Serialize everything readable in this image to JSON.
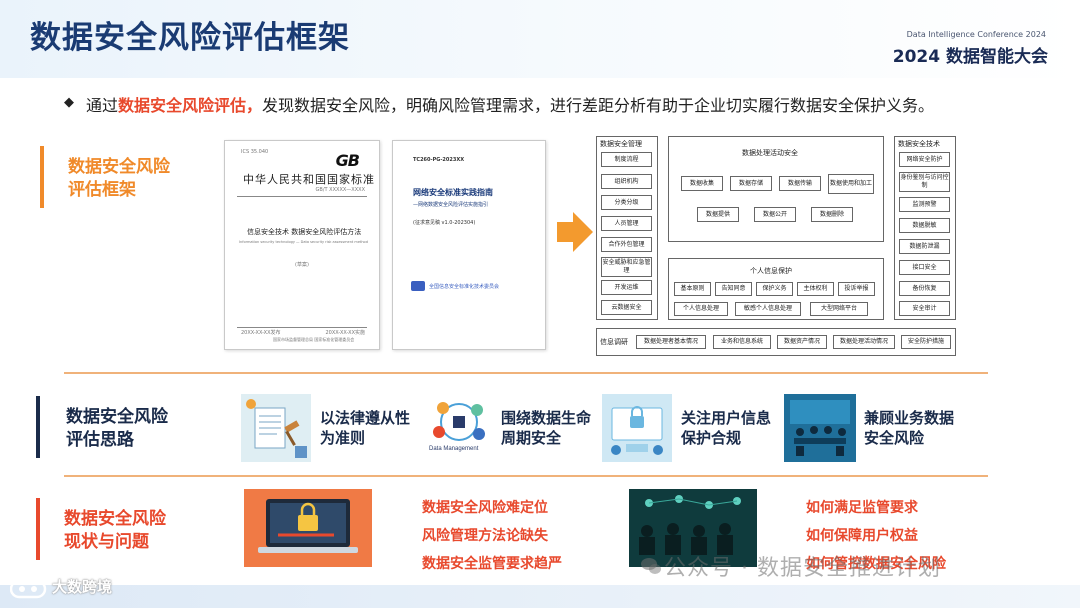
{
  "header": {
    "title": "数据安全风险评估框架",
    "conference_en": "Data Intelligence Conference 2024",
    "conference_cn": "2024 数据智能大会"
  },
  "intro": {
    "bullet": "◆",
    "prefix": "通过",
    "highlight": "数据安全风险评估，",
    "suffix": "发现数据安全风险，明确风险管理需求，进行差距分析有助于企业切实履行数据安全保护义务。"
  },
  "sections": {
    "framework": {
      "line1": "数据安全风险",
      "line2": "评估框架"
    },
    "thinking": {
      "line1": "数据安全风险",
      "line2": "评估思路"
    },
    "status": {
      "line1": "数据安全风险",
      "line2": "现状与问题"
    }
  },
  "doc_gb": {
    "code_small": "ICS 35.040",
    "logo": "GB",
    "standard": "中华人民共和国国家标准",
    "number": "GB/T XXXXX—XXXX",
    "title": "信息安全技术 数据安全风险评估方法",
    "title_en": "Information security technology — Data security risk assessment method",
    "draft": "(草案)",
    "date_pub": "20XX-XX-XX发布",
    "date_impl": "20XX-XX-XX实施",
    "issuer": "国家市场监督管理总局 国家标准化管理委员会"
  },
  "doc_tc": {
    "code": "TC260-PG-2023XX",
    "title": "网络安全标准实践指南",
    "subtitle": "—网络数据安全风险评估实施指引",
    "version": "(征求意见稿 v1.0-202304)",
    "org": "全国信息安全标准化技术委员会"
  },
  "framework": {
    "left_title": "数据安全管理",
    "left_items": [
      "制度流程",
      "组织机构",
      "分类分级",
      "人员管理",
      "合作外包管理",
      "安全威胁和应急管理",
      "开发运维",
      "云数据安全"
    ],
    "center_title": "数据处理活动安全",
    "center_row1": [
      "数据收集",
      "数据存储",
      "数据传输",
      "数据使用和加工"
    ],
    "center_row2": [
      "数据提供",
      "数据公开",
      "数据删除"
    ],
    "pi_title": "个人信息保护",
    "pi_row1": [
      "基本原则",
      "告知同意",
      "保护义务",
      "主体权利",
      "投诉举报"
    ],
    "pi_row2": [
      "个人信息处理",
      "敏感个人信息处理",
      "大型网络平台"
    ],
    "right_title": "数据安全技术",
    "right_items": [
      "网络安全防护",
      "身份鉴别与访问控制",
      "监测预警",
      "数据脱敏",
      "数据防泄漏",
      "接口安全",
      "备份恢复",
      "安全审计"
    ],
    "info_label": "信息调研",
    "info_items": [
      "数据处理者基本情况",
      "业务和信息系统",
      "数据资产情况",
      "数据处理活动情况",
      "安全防护措施"
    ]
  },
  "thinking": [
    {
      "line1": "以法律遵从性",
      "line2": "为准则",
      "icon": "legal-documents-icon"
    },
    {
      "line1": "围绕数据生命",
      "line2": "周期安全",
      "icon": "data-management-icon",
      "caption": "Data Management"
    },
    {
      "line1": "关注用户信息",
      "line2": "保护合规",
      "icon": "user-protection-icon"
    },
    {
      "line1": "兼顾业务数据",
      "line2": "安全风险",
      "icon": "business-meeting-icon"
    }
  ],
  "issues_left": [
    "数据安全风险难定位",
    "风险管理方法论缺失",
    "数据安全监管要求趋严"
  ],
  "issues_right": [
    "如何满足监管要求",
    "如何保障用户权益",
    "如何管控数据安全风险"
  ],
  "watermark": {
    "left": "大数跨境",
    "right": "公众号 · 数据安全推进计划"
  },
  "colors": {
    "title": "#1a3b73",
    "accent_orange": "#f08a2a",
    "accent_red": "#e8492d",
    "navy": "#1a2b4a"
  }
}
